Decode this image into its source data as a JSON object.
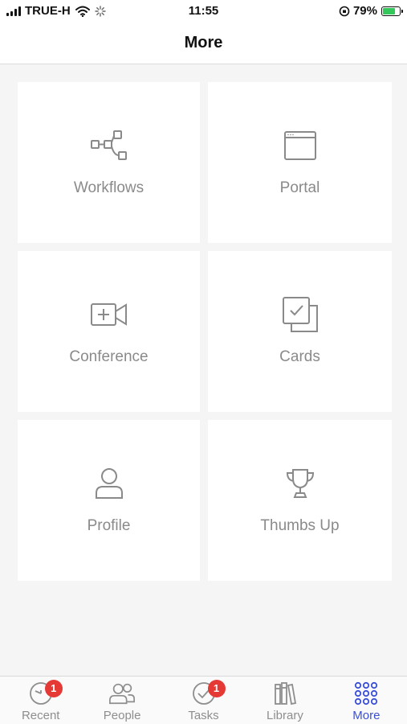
{
  "status_bar": {
    "carrier": "TRUE-H",
    "time": "11:55",
    "battery_percent": "79%",
    "battery_level": 0.79
  },
  "header": {
    "title": "More"
  },
  "tiles": [
    {
      "label": "Workflows",
      "icon": "workflow-icon"
    },
    {
      "label": "Portal",
      "icon": "browser-window-icon"
    },
    {
      "label": "Conference",
      "icon": "video-camera-icon"
    },
    {
      "label": "Cards",
      "icon": "cards-icon"
    },
    {
      "label": "Profile",
      "icon": "person-icon"
    },
    {
      "label": "Thumbs Up",
      "icon": "trophy-icon"
    }
  ],
  "tab_bar": {
    "tabs": [
      {
        "label": "Recent",
        "icon": "clock-icon",
        "badge": "1"
      },
      {
        "label": "People",
        "icon": "people-icon"
      },
      {
        "label": "Tasks",
        "icon": "check-circle-icon",
        "badge": "1"
      },
      {
        "label": "Library",
        "icon": "books-icon"
      },
      {
        "label": "More",
        "icon": "grid-icon",
        "active": true
      }
    ]
  },
  "colors": {
    "accent": "#3b4fd6",
    "badge": "#e53935",
    "icon_gray": "#8a8a8a",
    "battery_green": "#34c759"
  }
}
